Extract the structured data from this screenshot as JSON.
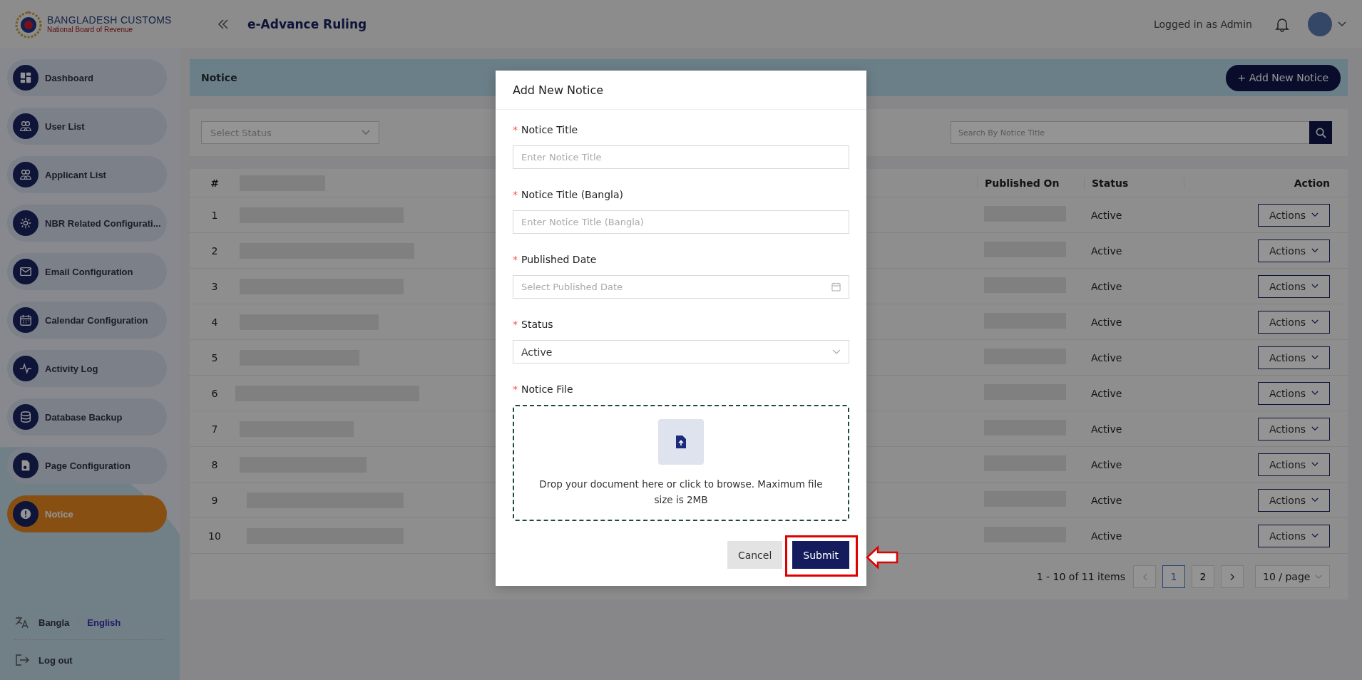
{
  "header": {
    "logo_title": "BANGLADESH CUSTOMS",
    "logo_subtitle": "National Board of Revenue",
    "app_title": "e-Advance Ruling",
    "user_label": "Logged in as Admin"
  },
  "sidebar": {
    "items": [
      {
        "label": "Dashboard",
        "selected": false
      },
      {
        "label": "User List",
        "selected": false
      },
      {
        "label": "Applicant List",
        "selected": false
      },
      {
        "label": "NBR Related Configurati...",
        "selected": false
      },
      {
        "label": "Email Configuration",
        "selected": false
      },
      {
        "label": "Calendar Configuration",
        "selected": false
      },
      {
        "label": "Activity Log",
        "selected": false
      },
      {
        "label": "Database Backup",
        "selected": false
      },
      {
        "label": "Page Configuration",
        "selected": false
      },
      {
        "label": "Notice",
        "selected": true
      }
    ],
    "languages": [
      {
        "label": "Bangla",
        "selected": false
      },
      {
        "label": "English",
        "selected": true
      }
    ],
    "logout": "Log out"
  },
  "page": {
    "title": "Notice",
    "add_button": "+ Add New Notice"
  },
  "filter": {
    "status_placeholder": "Select Status",
    "search_placeholder": "Search By Notice Title"
  },
  "table": {
    "columns": [
      "#",
      "Published On",
      "Status",
      "Action"
    ],
    "rows": [
      {
        "number": "1",
        "status": "Active",
        "action": "Actions"
      },
      {
        "number": "2",
        "status": "Active",
        "action": "Actions"
      },
      {
        "number": "3",
        "status": "Active",
        "action": "Actions"
      },
      {
        "number": "4",
        "status": "Active",
        "action": "Actions"
      },
      {
        "number": "5",
        "status": "Active",
        "action": "Actions"
      },
      {
        "number": "6",
        "status": "Active",
        "action": "Actions"
      },
      {
        "number": "7",
        "status": "Active",
        "action": "Actions"
      },
      {
        "number": "8",
        "status": "Active",
        "action": "Actions"
      },
      {
        "number": "9",
        "status": "Active",
        "action": "Actions"
      },
      {
        "number": "10",
        "status": "Active",
        "action": "Actions"
      }
    ]
  },
  "pagination": {
    "summary": "1 - 10 of 11 items",
    "pages": [
      {
        "label": "1",
        "selected": true
      },
      {
        "label": "2",
        "selected": false
      }
    ],
    "page_size": "10 / page"
  },
  "modal": {
    "title": "Add New Notice",
    "fields": [
      {
        "kind": "text",
        "required_mark": "*",
        "label": "Notice Title",
        "placeholder": "Enter Notice Title"
      },
      {
        "kind": "text",
        "required_mark": "*",
        "label": "Notice Title (Bangla)",
        "placeholder": "Enter Notice Title (Bangla)"
      },
      {
        "kind": "date",
        "required_mark": "*",
        "label": "Published Date",
        "placeholder": "Select Published Date"
      },
      {
        "kind": "select",
        "required_mark": "*",
        "label": "Status",
        "value": "Active"
      },
      {
        "kind": "upload",
        "required_mark": "*",
        "label": "Notice File",
        "hint": "Drop your document here or click to browse. Maximum file size is 2MB"
      }
    ],
    "buttons": [
      {
        "kind": "secondary",
        "label": "Cancel",
        "highlighted": false
      },
      {
        "kind": "primary",
        "label": "Submit",
        "highlighted": true
      }
    ]
  }
}
